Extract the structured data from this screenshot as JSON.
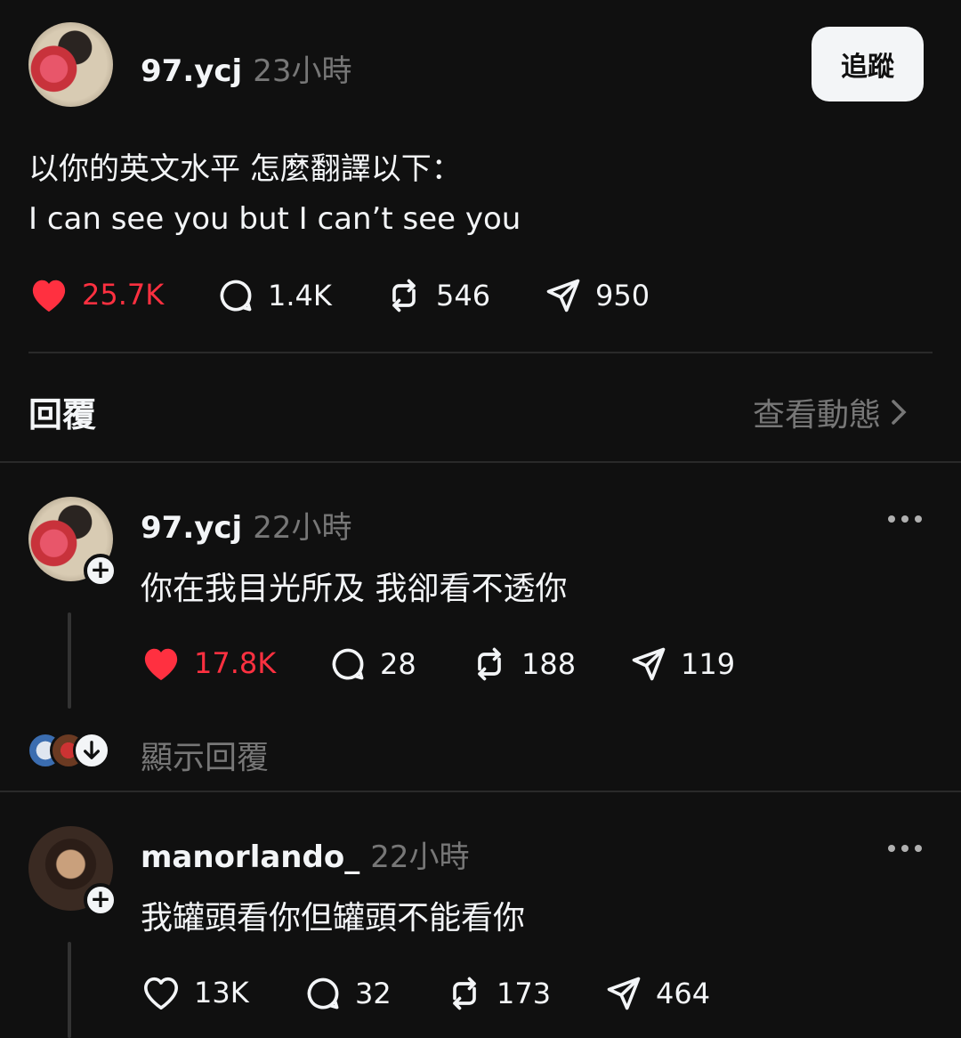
{
  "post": {
    "username": "97.ycj",
    "time": "23小時",
    "follow_label": "追蹤",
    "text_line1": "以你的英文水平 怎麼翻譯以下：",
    "text_line2": "I can see you but I can’t see you",
    "likes": "25.7K",
    "comments": "1.4K",
    "reposts": "546",
    "shares": "950"
  },
  "replies_header": {
    "title": "回覆",
    "view_activity": "查看動態"
  },
  "replies": [
    {
      "username": "97.ycj",
      "time": "22小時",
      "text": "你在我目光所及 我卻看不透你",
      "likes": "17.8K",
      "liked": true,
      "comments": "28",
      "reposts": "188",
      "shares": "119",
      "show_replies": "顯示回覆"
    },
    {
      "username": "manorlando_",
      "time": "22小時",
      "text": "我罐頭看你但罐頭不能看你",
      "likes": "13K",
      "liked": false,
      "comments": "32",
      "reposts": "173",
      "shares": "464"
    }
  ],
  "colors": {
    "background": "#101010",
    "liked": "#ff3040",
    "muted": "#777777"
  },
  "icons": [
    "heart-icon",
    "comment-icon",
    "repost-icon",
    "share-icon",
    "plus-icon",
    "more-icon",
    "chevron-right-icon",
    "arrow-down-icon"
  ]
}
